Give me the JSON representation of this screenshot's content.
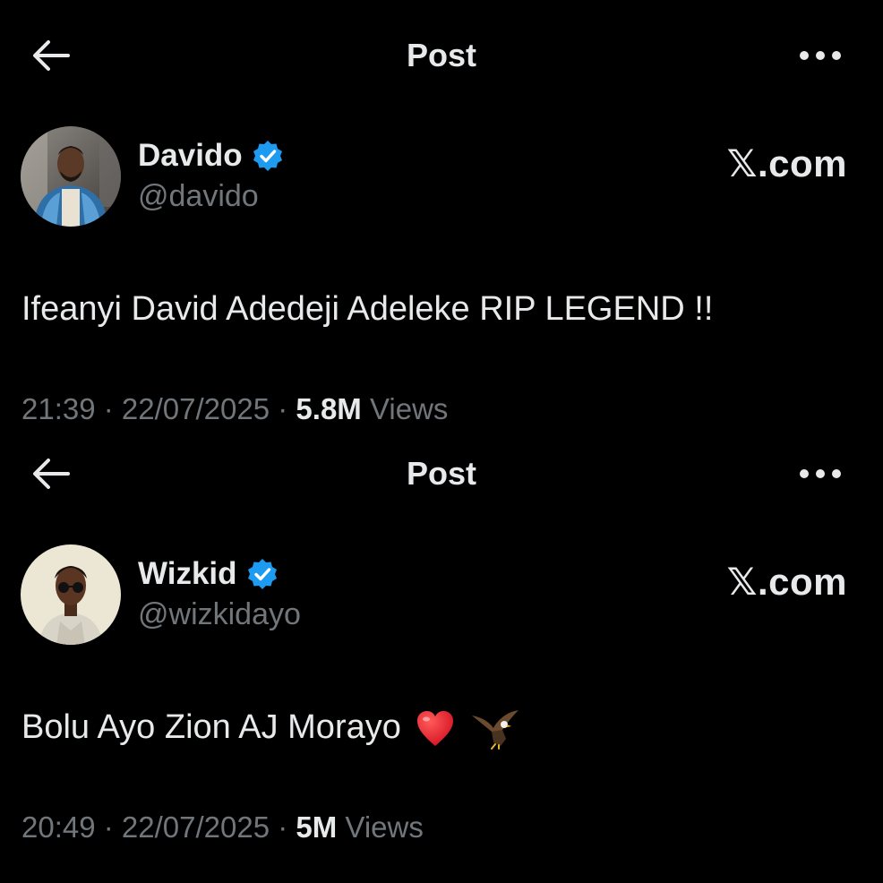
{
  "posts": [
    {
      "header": {
        "title": "Post"
      },
      "author": {
        "name": "Davido",
        "handle": "@davido",
        "verified": true
      },
      "brand": "𝕏.com",
      "text": "Ifeanyi David Adedeji Adeleke RIP LEGEND !!",
      "emojis": [],
      "meta": {
        "time": "21:39",
        "sep1": " · ",
        "date": "22/07/2025",
        "sep2": " · ",
        "views_count": "5.8M",
        "views_label": " Views"
      }
    },
    {
      "header": {
        "title": "Post"
      },
      "author": {
        "name": "Wizkid",
        "handle": "@wizkidayo",
        "verified": true
      },
      "brand": "𝕏.com",
      "text": "Bolu Ayo Zion AJ Morayo",
      "emojis": [
        "red-heart-icon",
        "eagle-icon"
      ],
      "meta": {
        "time": "20:49",
        "sep1": " · ",
        "date": "22/07/2025",
        "sep2": " · ",
        "views_count": "5M",
        "views_label": " Views"
      }
    }
  ],
  "colors": {
    "background": "#000000",
    "primary_text": "#e7e9ea",
    "secondary_text": "#71767b",
    "verified_badge": "#1d9bf0"
  }
}
